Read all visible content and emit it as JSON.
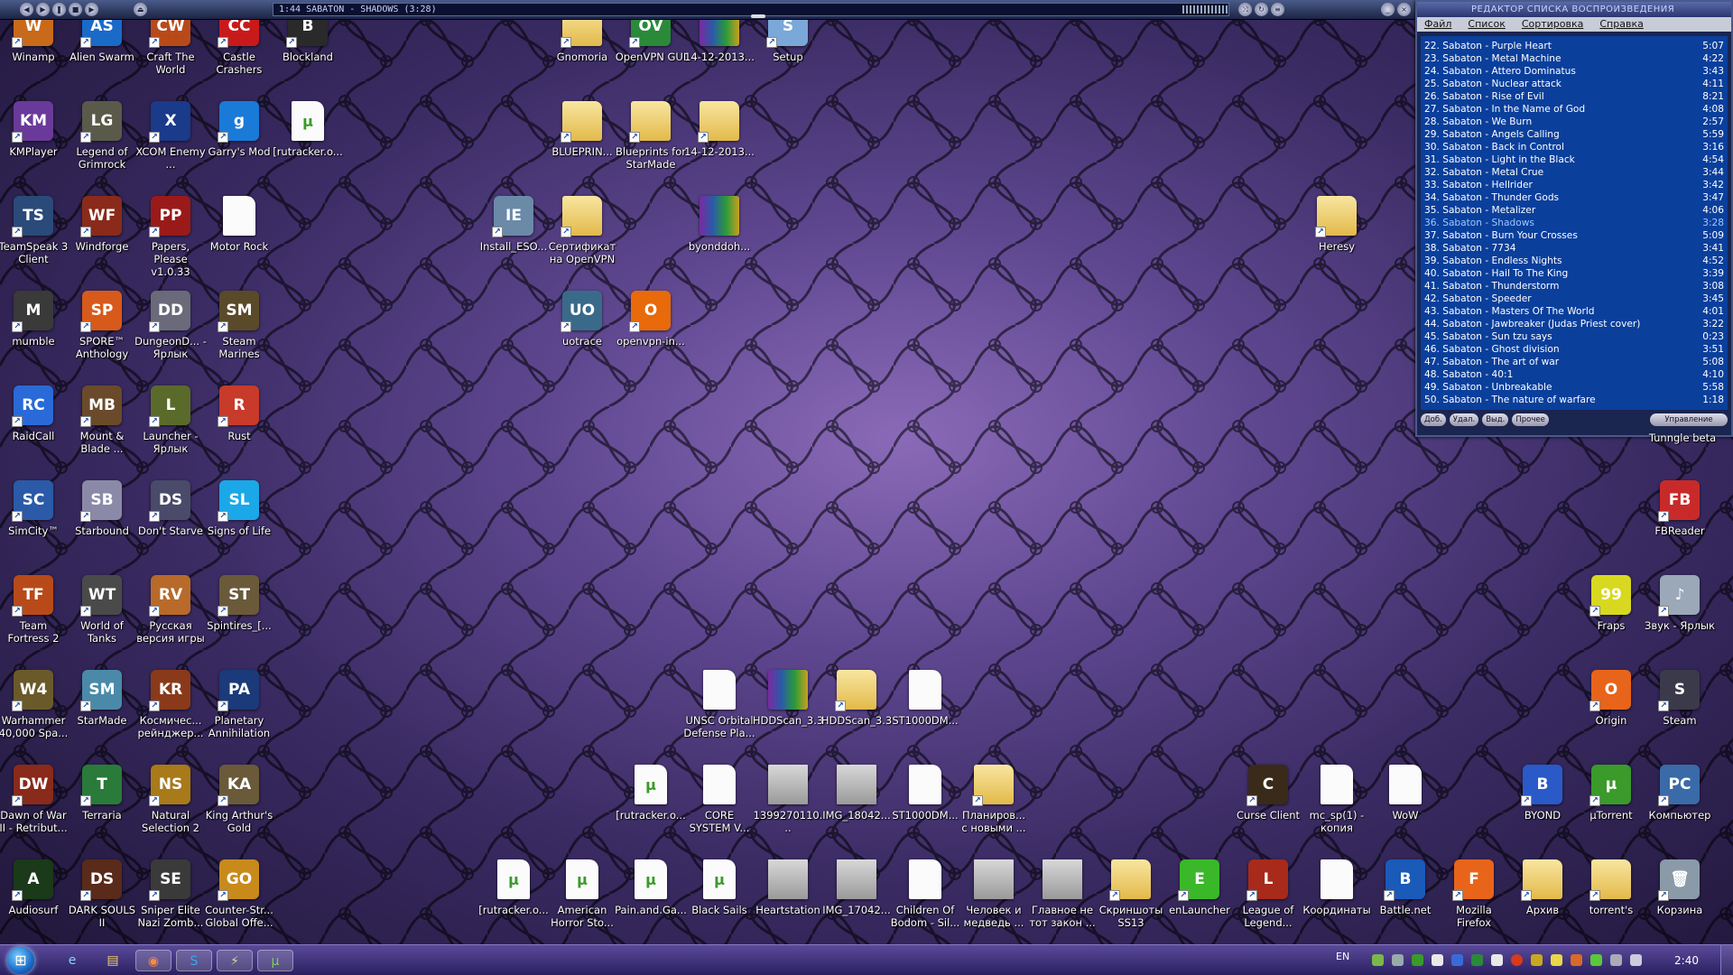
{
  "colors": {
    "accent": "#0a3f9c",
    "taskbar": "#3a2b73",
    "wallpaper": "#5f4790"
  },
  "winamp": {
    "display": "1:44   SABATON - SHADOWS (3:28)"
  },
  "playlist": {
    "title": "РЕДАКТОР СПИСКА ВОСПРОИЗВЕДЕНИЯ",
    "menu": [
      "Файл",
      "Список",
      "Сортировка",
      "Справка"
    ],
    "items": [
      {
        "t": "22. Sabaton - Purple Heart",
        "d": "5:07"
      },
      {
        "t": "23. Sabaton - Metal Machine",
        "d": "4:22"
      },
      {
        "t": "24. Sabaton - Attero Dominatus",
        "d": "3:43"
      },
      {
        "t": "25. Sabaton - Nuclear attack",
        "d": "4:11"
      },
      {
        "t": "26. Sabaton - Rise of Evil",
        "d": "8:21"
      },
      {
        "t": "27. Sabaton - In the Name of God",
        "d": "4:08"
      },
      {
        "t": "28. Sabaton - We Burn",
        "d": "2:57"
      },
      {
        "t": "29. Sabaton - Angels Calling",
        "d": "5:59"
      },
      {
        "t": "30. Sabaton - Back in Control",
        "d": "3:16"
      },
      {
        "t": "31. Sabaton - Light in the Black",
        "d": "4:54"
      },
      {
        "t": "32. Sabaton - Metal Crue",
        "d": "3:44"
      },
      {
        "t": "33. Sabaton - Hellrider",
        "d": "3:42"
      },
      {
        "t": "34. Sabaton - Thunder Gods",
        "d": "3:47"
      },
      {
        "t": "35. Sabaton - Metalizer",
        "d": "4:06"
      },
      {
        "t": "36. Sabaton - Shadows",
        "d": "3:28",
        "cur": true
      },
      {
        "t": "37. Sabaton - Burn Your Crosses",
        "d": "5:09"
      },
      {
        "t": "38. Sabaton - 7734",
        "d": "3:41"
      },
      {
        "t": "39. Sabaton - Endless Nights",
        "d": "4:52"
      },
      {
        "t": "40. Sabaton - Hail To The King",
        "d": "3:39"
      },
      {
        "t": "41. Sabaton - Thunderstorm",
        "d": "3:08"
      },
      {
        "t": "42. Sabaton - Speeder",
        "d": "3:45"
      },
      {
        "t": "43. Sabaton - Masters Of The World",
        "d": "4:01"
      },
      {
        "t": "44. Sabaton - Jawbreaker (Judas Priest cover)",
        "d": "3:22"
      },
      {
        "t": "45. Sabaton - Sun tzu says",
        "d": "0:23"
      },
      {
        "t": "46. Sabaton - Ghost division",
        "d": "3:51"
      },
      {
        "t": "47. Sabaton - The art of war",
        "d": "5:08"
      },
      {
        "t": "48. Sabaton - 40:1",
        "d": "4:10"
      },
      {
        "t": "49. Sabaton - Unbreakable",
        "d": "5:58"
      },
      {
        "t": "50. Sabaton - The nature of warfare",
        "d": "1:18"
      }
    ],
    "buttons": [
      "Доб.",
      "Удал.",
      "Выд.",
      "Прочее",
      "Управление"
    ]
  },
  "desktop": {
    "icons": [
      {
        "label": "Winamp",
        "icon": "winamp-icon",
        "color": "#c86a1a",
        "g": "W"
      },
      {
        "label": "Alien Swarm",
        "icon": "alien-swarm-icon",
        "color": "#1a6ac8",
        "g": "AS"
      },
      {
        "label": "Craft The World",
        "icon": "craft-the-world-icon",
        "color": "#b84a1a",
        "g": "CW"
      },
      {
        "label": "Castle Crashers",
        "icon": "castle-crashers-icon",
        "color": "#c81a1a",
        "g": "CC"
      },
      {
        "label": "Blockland",
        "icon": "blockland-icon",
        "color": "#2a2a2a",
        "g": "B"
      },
      {
        "label": "Gnomoria",
        "icon": "folder-icon",
        "kind": "folder"
      },
      {
        "label": "OpenVPN GUI",
        "icon": "openvpn-gui-icon",
        "color": "#2a8a3a",
        "g": "OV"
      },
      {
        "label": "14-12-2013...",
        "icon": "archive-icon",
        "kind": "archive"
      },
      {
        "label": "Setup",
        "icon": "setup-icon",
        "color": "#7aa8d8",
        "g": "S"
      },
      {
        "label": "KMPlayer",
        "icon": "kmplayer-icon",
        "color": "#6a3a9a",
        "g": "KM"
      },
      {
        "label": "Legend of Grimrock",
        "icon": "legend-of-grimrock-icon",
        "color": "#5a5a4a",
        "g": "LG"
      },
      {
        "label": "XCOM Enemy ...",
        "icon": "xcom-icon",
        "color": "#1a3a8a",
        "g": "X"
      },
      {
        "label": "Garry's Mod",
        "icon": "garrys-mod-icon",
        "color": "#1a7ad8",
        "g": "g"
      },
      {
        "label": "[rutracker.o...",
        "icon": "torrent-file-icon",
        "kind": "torrent"
      },
      {
        "label": "BLUEPRIN...",
        "icon": "folder-icon",
        "kind": "folder"
      },
      {
        "label": "Blueprints for StarMade",
        "icon": "folder-icon",
        "kind": "folder"
      },
      {
        "label": "14-12-2013...",
        "icon": "folder-icon",
        "kind": "folder"
      },
      {
        "label": "TeamSpeak 3 Client",
        "icon": "teamspeak-icon",
        "color": "#2a4a7a",
        "g": "TS"
      },
      {
        "label": "Windforge",
        "icon": "windforge-icon",
        "color": "#8a2a1a",
        "g": "WF"
      },
      {
        "label": "Papers, Please v1.0.33",
        "icon": "papers-please-icon",
        "color": "#9a1a1a",
        "g": "PP"
      },
      {
        "label": "Motor Rock",
        "icon": "file-icon",
        "kind": "file"
      },
      {
        "label": "Install_ESO...",
        "icon": "install-eso-icon",
        "color": "#6a8aa8",
        "g": "IE"
      },
      {
        "label": "Сертификат на OpenVPN",
        "icon": "folder-icon",
        "kind": "folder"
      },
      {
        "label": "byonddoh...",
        "icon": "archive-icon",
        "kind": "archive"
      },
      {
        "label": "Heresy",
        "icon": "folder-icon",
        "kind": "folder"
      },
      {
        "label": "mumble",
        "icon": "mumble-icon",
        "color": "#3a3a3a",
        "g": "M"
      },
      {
        "label": "SPORE™ Anthology",
        "icon": "spore-icon",
        "color": "#d85a1a",
        "g": "SP"
      },
      {
        "label": "DungeonD... - Ярлык",
        "icon": "dungeon-defenders-icon",
        "color": "#6a6a7a",
        "g": "DD"
      },
      {
        "label": "Steam Marines",
        "icon": "steam-marines-icon",
        "color": "#5a4a2a",
        "g": "SM"
      },
      {
        "label": "uotrace",
        "icon": "uotrace-icon",
        "color": "#3a6a8a",
        "g": "UO"
      },
      {
        "label": "openvpn-in...",
        "icon": "openvpn-icon",
        "color": "#e86a0a",
        "g": "O"
      },
      {
        "label": "RaidCall",
        "icon": "raidcall-icon",
        "color": "#2a6ad8",
        "g": "RC"
      },
      {
        "label": "Mount & Blade ...",
        "icon": "mount-blade-icon",
        "color": "#6a4a2a",
        "g": "MB"
      },
      {
        "label": "Launcher - Ярлык",
        "icon": "launcher-icon",
        "color": "#5a6a2a",
        "g": "L"
      },
      {
        "label": "Rust",
        "icon": "rust-icon",
        "color": "#c83a2a",
        "g": "R"
      },
      {
        "label": "SimCity™",
        "icon": "simcity-icon",
        "color": "#2a5aa8",
        "g": "SC"
      },
      {
        "label": "Starbound",
        "icon": "starbound-icon",
        "color": "#8a8aa8",
        "g": "SB"
      },
      {
        "label": "Don't Starve",
        "icon": "dont-starve-icon",
        "color": "#4a4a6a",
        "g": "DS"
      },
      {
        "label": "Signs of Life",
        "icon": "signs-of-life-icon",
        "color": "#1aa8e8",
        "g": "SL"
      },
      {
        "label": "FBReader",
        "icon": "fbreader-icon",
        "color": "#c82a2a",
        "g": "FB"
      },
      {
        "label": "Team Fortress 2",
        "icon": "tf2-icon",
        "color": "#b84a1a",
        "g": "TF"
      },
      {
        "label": "World of Tanks",
        "icon": "world-of-tanks-icon",
        "color": "#4a4a4a",
        "g": "WT"
      },
      {
        "label": "Русская версия игры",
        "icon": "russian-version-icon",
        "color": "#b86a2a",
        "g": "RV"
      },
      {
        "label": "Spintires_[...",
        "icon": "spintires-icon",
        "color": "#6a5a3a",
        "g": "ST"
      },
      {
        "label": "Fraps",
        "icon": "fraps-icon",
        "color": "#d8d820",
        "g": "99"
      },
      {
        "label": "Звук - Ярлык",
        "icon": "sound-icon",
        "color": "#9aa8b8",
        "g": "♪"
      },
      {
        "label": "Warhammer 40,000 Spa...",
        "icon": "warhammer-icon",
        "color": "#6a5a2a",
        "g": "W4"
      },
      {
        "label": "StarMade",
        "icon": "starmade-icon",
        "color": "#4a8aa8",
        "g": "SM"
      },
      {
        "label": "Космичес... рейнджер...",
        "icon": "space-rangers-icon",
        "color": "#8a3a1a",
        "g": "KR"
      },
      {
        "label": "Planetary Annihilation",
        "icon": "planetary-annihilation-icon",
        "color": "#1a3a7a",
        "g": "PA"
      },
      {
        "label": "Origin",
        "icon": "origin-icon",
        "color": "#e8641a",
        "g": "O"
      },
      {
        "label": "Steam",
        "icon": "steam-icon",
        "color": "#3a3a4a",
        "g": "S"
      },
      {
        "label": "UNSC Orbital Defense Pla...",
        "icon": "file-icon",
        "kind": "file"
      },
      {
        "label": "HDDScan_3.3",
        "icon": "archive-icon",
        "kind": "archive"
      },
      {
        "label": "HDDScan_3.3",
        "icon": "folder-icon",
        "kind": "folder"
      },
      {
        "label": "ST1000DM...",
        "icon": "file-icon",
        "kind": "file"
      },
      {
        "label": "Dawn of War II - Retribut...",
        "icon": "dawn-of-war-icon",
        "color": "#8a2a1a",
        "g": "DW"
      },
      {
        "label": "Terraria",
        "icon": "terraria-icon",
        "color": "#2a7a3a",
        "g": "T"
      },
      {
        "label": "Natural Selection 2",
        "icon": "natural-selection-icon",
        "color": "#a87a1a",
        "g": "NS"
      },
      {
        "label": "King Arthur's Gold",
        "icon": "king-arthurs-gold-icon",
        "color": "#6a5a3a",
        "g": "KA"
      },
      {
        "label": "[rutracker.o...",
        "icon": "torrent-file-icon",
        "kind": "torrent"
      },
      {
        "label": "CORE SYSTEM V...",
        "icon": "file-icon",
        "kind": "file"
      },
      {
        "label": "1399270110...",
        "icon": "image-icon",
        "kind": "img"
      },
      {
        "label": "IMG_18042...",
        "icon": "image-icon",
        "kind": "img"
      },
      {
        "label": "ST1000DM...",
        "icon": "file-icon",
        "kind": "file"
      },
      {
        "label": "Планиров... с новыми ...",
        "icon": "folder-icon",
        "kind": "folder"
      },
      {
        "label": "Curse Client",
        "icon": "curse-client-icon",
        "color": "#3a2a1a",
        "g": "C"
      },
      {
        "label": "mc_sp(1) - копия",
        "icon": "file-icon",
        "kind": "file"
      },
      {
        "label": "WoW",
        "icon": "file-icon",
        "kind": "file"
      },
      {
        "label": "BYOND",
        "icon": "byond-icon",
        "color": "#2a5ac8",
        "g": "B"
      },
      {
        "label": "µTorrent",
        "icon": "utorrent-icon",
        "color": "#3a9a2a",
        "g": "µ"
      },
      {
        "label": "Компьютер",
        "icon": "computer-icon",
        "color": "#3a6aa8",
        "g": "PC"
      },
      {
        "label": "Audiosurf",
        "icon": "audiosurf-icon",
        "color": "#1a3a1a",
        "g": "A"
      },
      {
        "label": "DARK SOULS II",
        "icon": "dark-souls-icon",
        "color": "#5a2a1a",
        "g": "DS"
      },
      {
        "label": "Sniper Elite Nazi Zomb...",
        "icon": "sniper-elite-icon",
        "color": "#3a3a3a",
        "g": "SE"
      },
      {
        "label": "Counter-Str... Global Offe...",
        "icon": "counter-strike-icon",
        "color": "#c88a1a",
        "g": "GO"
      },
      {
        "label": "[rutracker.o...",
        "icon": "torrent-file-icon",
        "kind": "torrent"
      },
      {
        "label": "American Horror Sto...",
        "icon": "torrent-file-icon",
        "kind": "torrent"
      },
      {
        "label": "Pain.and.Ga...",
        "icon": "torrent-file-icon",
        "kind": "torrent"
      },
      {
        "label": "Black Sails",
        "icon": "torrent-file-icon",
        "kind": "torrent"
      },
      {
        "label": "Heartstation",
        "icon": "image-icon",
        "kind": "img"
      },
      {
        "label": "IMG_17042...",
        "icon": "image-icon",
        "kind": "img"
      },
      {
        "label": "Children Of Bodom - Sil...",
        "icon": "file-icon",
        "kind": "file"
      },
      {
        "label": "Человек и медведь ...",
        "icon": "image-icon",
        "kind": "img"
      },
      {
        "label": "Главное не тот закон ...",
        "icon": "image-icon",
        "kind": "img"
      },
      {
        "label": "Скриншоты SS13",
        "icon": "folder-icon",
        "kind": "folder"
      },
      {
        "label": "enLauncher",
        "icon": "enlauncher-icon",
        "color": "#3ab82a",
        "g": "E"
      },
      {
        "label": "League of Legend...",
        "icon": "league-of-legends-icon",
        "color": "#a82a1a",
        "g": "L"
      },
      {
        "label": "Координаты",
        "icon": "file-icon",
        "kind": "file"
      },
      {
        "label": "Battle.net",
        "icon": "battlenet-icon",
        "color": "#1a5ab8",
        "g": "B"
      },
      {
        "label": "Mozilla Firefox",
        "icon": "firefox-icon",
        "color": "#e8641a",
        "g": "F"
      },
      {
        "label": "Архив",
        "icon": "folder-icon",
        "kind": "folder"
      },
      {
        "label": "torrent's",
        "icon": "folder-icon",
        "kind": "folder"
      },
      {
        "label": "Корзина",
        "icon": "recycle-bin-icon",
        "color": "#8a9aa8",
        "g": "🗑"
      }
    ]
  },
  "tungle": "Tunngle beta",
  "taskbar": {
    "lang": "EN",
    "clock": "2:40"
  }
}
